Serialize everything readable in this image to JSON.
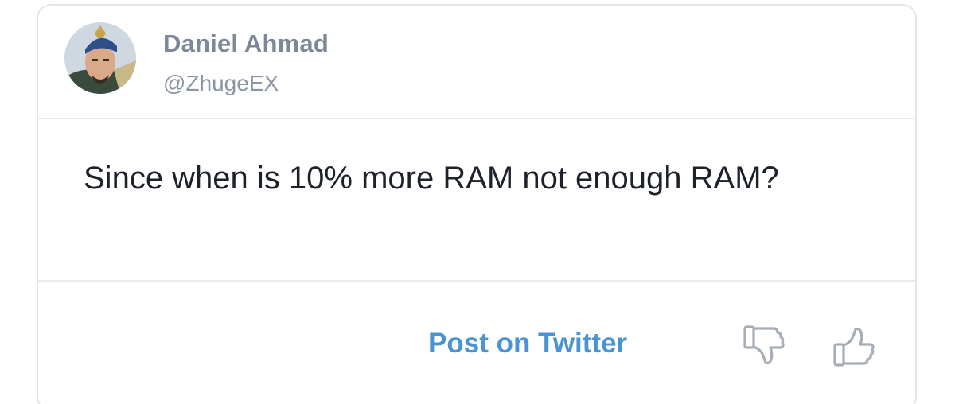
{
  "author": {
    "display_name": "Daniel Ahmad",
    "handle": "@ZhugeEX",
    "avatar_icon": "profile-avatar"
  },
  "tweet": {
    "text": "Since when is 10% more RAM not enough RAM?"
  },
  "actions": {
    "post_label": "Post on Twitter",
    "dislike_icon": "thumbs-down-icon",
    "like_icon": "thumbs-up-icon"
  },
  "colors": {
    "link": "#4a94d6",
    "name": "#7d8797",
    "text": "#1d2129",
    "border": "#e3e5ea"
  }
}
